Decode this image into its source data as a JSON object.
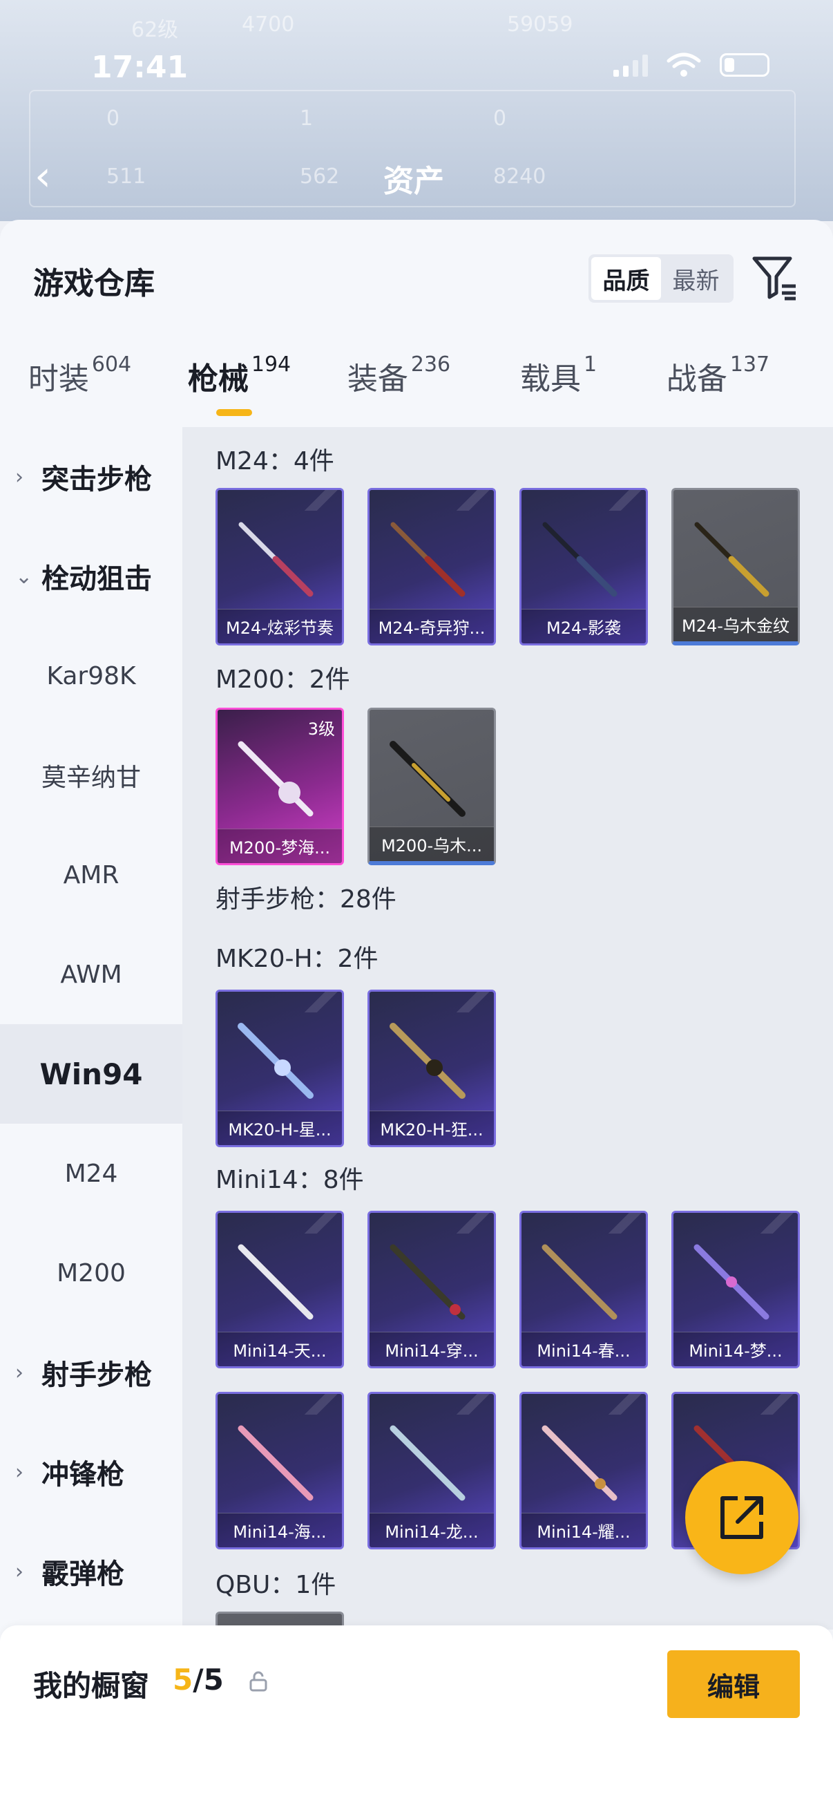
{
  "status_bar": {
    "time": "17:41"
  },
  "top_header": {
    "title": "资产",
    "ghost_items": [
      "62级",
      "4700",
      "59059",
      "0",
      "1",
      "0",
      "511",
      "562",
      "8240"
    ]
  },
  "panel": {
    "title": "游戏仓库",
    "sort_options": [
      "品质",
      "最新"
    ],
    "tabs": [
      {
        "label": "时装",
        "count": "604"
      },
      {
        "label": "枪械",
        "count": "194"
      },
      {
        "label": "装备",
        "count": "236"
      },
      {
        "label": "载具",
        "count": "1"
      },
      {
        "label": "战备",
        "count": "137"
      }
    ]
  },
  "sidebar": {
    "items": [
      {
        "label": "突击步枪",
        "group": true,
        "chev": "›"
      },
      {
        "label": "栓动狙击",
        "group": true,
        "chev": "⌄"
      },
      {
        "label": "Kar98K"
      },
      {
        "label": "莫辛纳甘"
      },
      {
        "label": "AMR"
      },
      {
        "label": "AWM"
      },
      {
        "label": "Win94"
      },
      {
        "label": "M24"
      },
      {
        "label": "M200"
      },
      {
        "label": "射手步枪",
        "group": true,
        "chev": "›"
      },
      {
        "label": "冲锋枪",
        "group": true,
        "chev": "›"
      },
      {
        "label": "霰弹枪",
        "group": true,
        "chev": "›"
      }
    ]
  },
  "sections": {
    "m24": {
      "title": "M24：4件",
      "cards": [
        "M24-炫彩节奏",
        "M24-奇异狩...",
        "M24-影袭",
        "M24-乌木金纹"
      ]
    },
    "m200": {
      "title": "M200：2件",
      "cards": [
        "M200-梦海...",
        "M200-乌木..."
      ],
      "level": "3级"
    },
    "dmr": {
      "title": "射手步枪：28件"
    },
    "mk20": {
      "title": "MK20-H：2件",
      "cards": [
        "MK20-H-星...",
        "MK20-H-狂..."
      ]
    },
    "mini14": {
      "title": "Mini14：8件",
      "cards": [
        "Mini14-天...",
        "Mini14-穿...",
        "Mini14-春...",
        "Mini14-梦...",
        "Mini14-海...",
        "Mini14-龙...",
        "Mini14-耀..."
      ]
    },
    "qbu": {
      "title": "QBU：1件"
    }
  },
  "bottom": {
    "label": "我的橱窗",
    "current": "5",
    "slash": "/",
    "total": "5",
    "edit_label": "编辑"
  },
  "colors": {
    "accent": "#f6b518",
    "epic_border": "#7a6ee0",
    "legendary_border": "#ff4fd8"
  }
}
